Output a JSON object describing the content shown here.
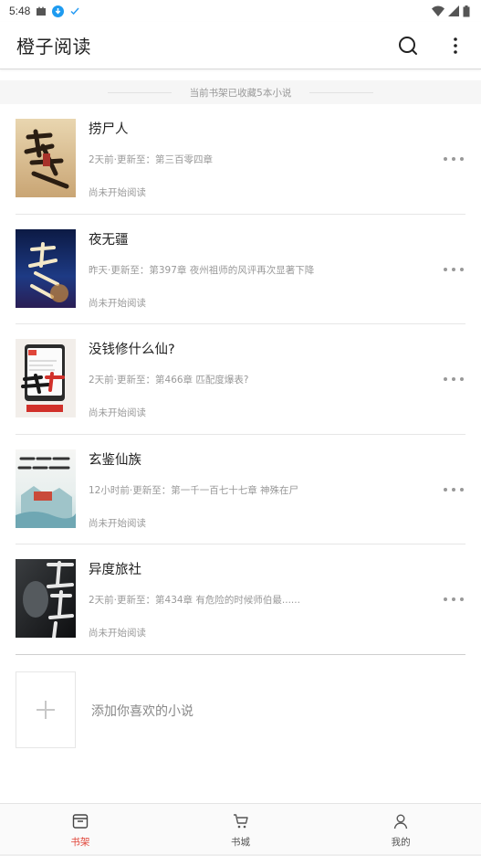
{
  "status_bar": {
    "time": "5:48"
  },
  "app": {
    "title": "橙子阅读"
  },
  "shelf": {
    "notice": "当前书架已收藏5本小说"
  },
  "books": [
    {
      "title": "捞尸人",
      "update": "2天前·更新至：第三百零四章",
      "progress": "尚未开始阅读",
      "cover_text": "捞尸人"
    },
    {
      "title": "夜无疆",
      "update": "昨天·更新至：第397章 夜州祖师的风评再次显著下降",
      "progress": "尚未开始阅读",
      "cover_text": "夜无疆"
    },
    {
      "title": "没钱修什么仙?",
      "update": "2天前·更新至：第466章 匹配度爆表?",
      "progress": "尚未开始阅读",
      "cover_text": "没钱修什么仙?"
    },
    {
      "title": "玄鉴仙族",
      "update": "12小时前·更新至：第一千一百七十七章 神殊在尸",
      "progress": "尚未开始阅读",
      "cover_text": "玄鉴仙族"
    },
    {
      "title": "异度旅社",
      "update": "2天前·更新至：第434章 有危险的时候师伯最......",
      "progress": "尚未开始阅读",
      "cover_text": "异度旅社"
    }
  ],
  "add": {
    "label": "添加你喜欢的小说"
  },
  "nav": [
    {
      "label": "书架",
      "icon": "bookshelf-icon",
      "active": true
    },
    {
      "label": "书城",
      "icon": "cart-icon",
      "active": false
    },
    {
      "label": "我的",
      "icon": "profile-icon",
      "active": false
    }
  ],
  "colors": {
    "accent": "#e0463a",
    "text": "#222222",
    "muted": "#999999"
  }
}
